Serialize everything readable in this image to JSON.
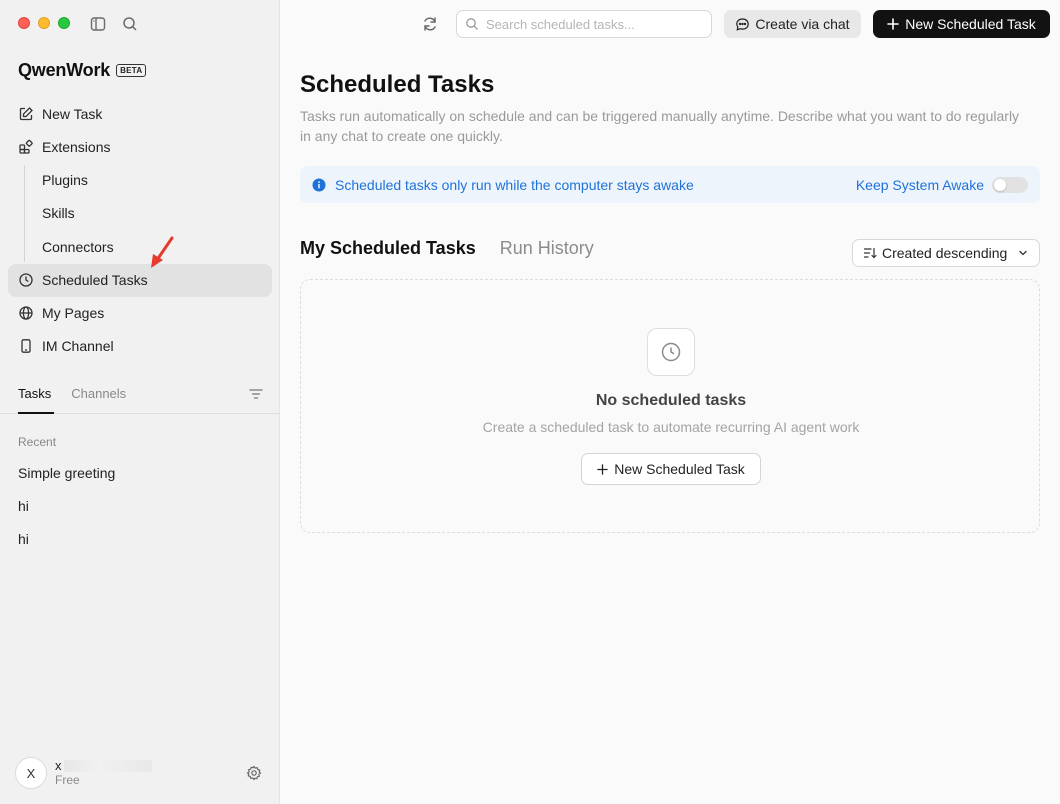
{
  "app": {
    "logo_text": "QwenWork",
    "logo_badge": "BETA"
  },
  "sidebar": {
    "nav": {
      "new_task": "New Task",
      "extensions": "Extensions",
      "plugins": "Plugins",
      "skills": "Skills",
      "connectors": "Connectors",
      "scheduled_tasks": "Scheduled Tasks",
      "my_pages": "My Pages",
      "im_channel": "IM Channel"
    },
    "tabs": {
      "tasks": "Tasks",
      "channels": "Channels"
    },
    "recent_label": "Recent",
    "recent_items": [
      "Simple greeting",
      "hi",
      "hi"
    ],
    "user": {
      "avatar_initial": "X",
      "name_initial": "x",
      "plan": "Free"
    }
  },
  "header": {
    "search_placeholder": "Search scheduled tasks...",
    "create_via_chat": "Create via chat",
    "new_scheduled_task": "New Scheduled Task"
  },
  "main": {
    "title": "Scheduled Tasks",
    "description": "Tasks run automatically on schedule and can be triggered manually anytime. Describe what you want to do regularly in any chat to create one quickly.",
    "banner": {
      "text": "Scheduled tasks only run while the computer stays awake",
      "keep_awake_label": "Keep System Awake",
      "keep_awake_on": false
    },
    "tabs": {
      "my_scheduled": "My Scheduled Tasks",
      "run_history": "Run History"
    },
    "sort_label": "Created descending",
    "empty": {
      "title": "No scheduled tasks",
      "subtitle": "Create a scheduled task to automate recurring AI agent work",
      "button": "New Scheduled Task"
    }
  },
  "colors": {
    "accent_blue": "#1f73d8",
    "banner_bg": "#eef4fb",
    "primary_button": "#121212",
    "annotation_arrow": "#e53a2c"
  }
}
